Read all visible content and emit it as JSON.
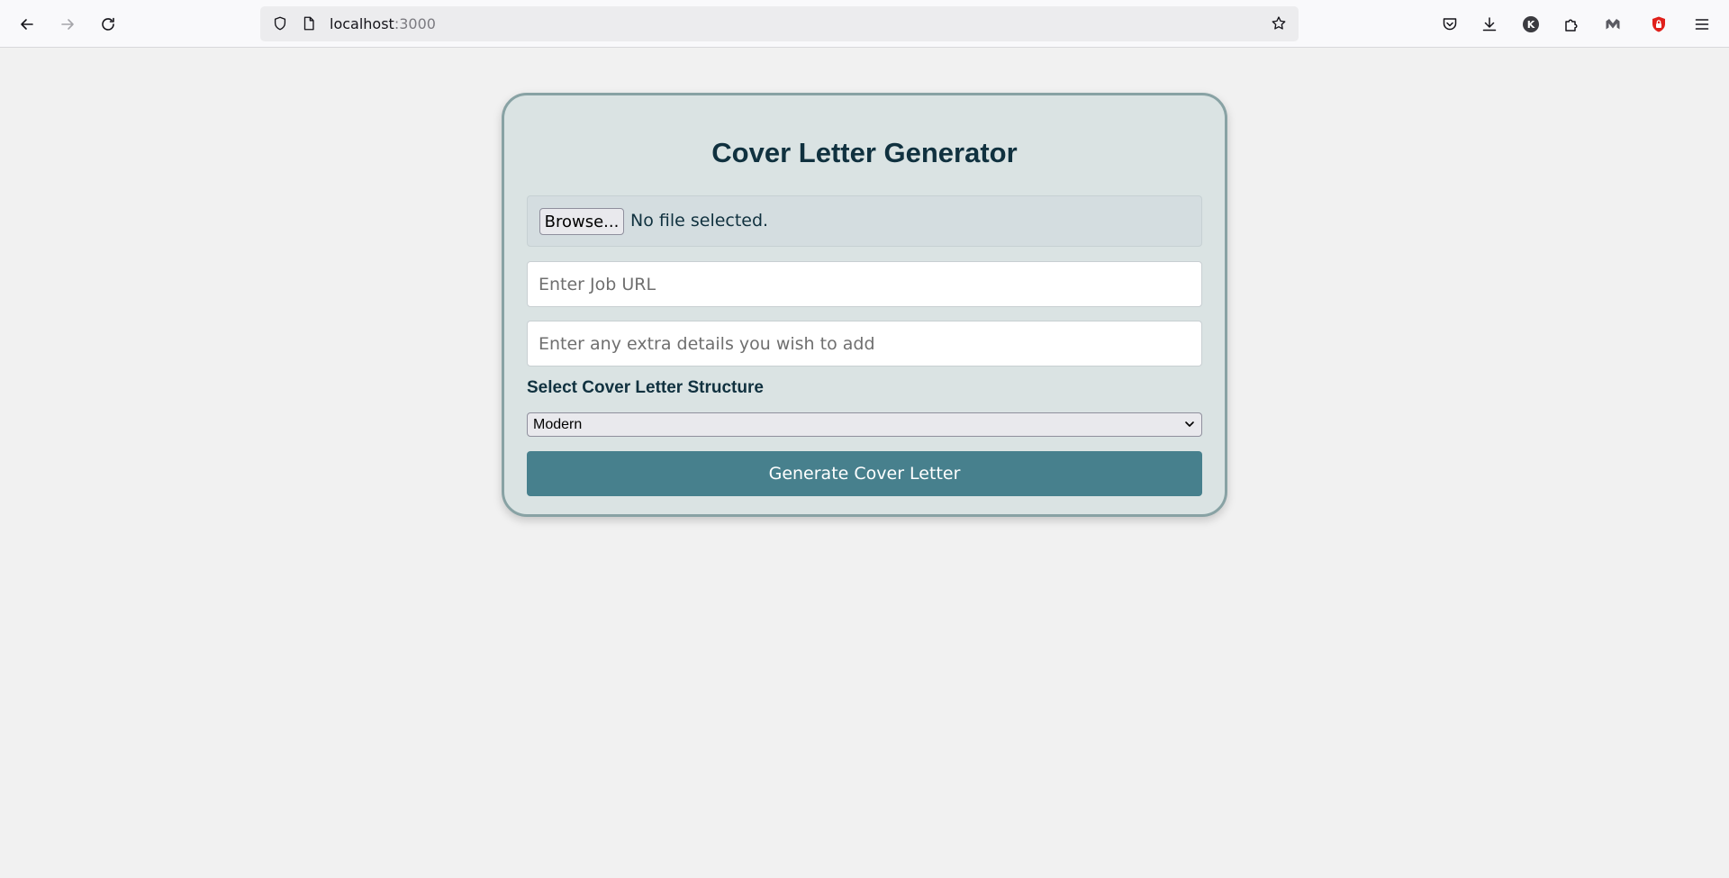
{
  "browser": {
    "url_host": "localhost",
    "url_port": ":3000",
    "icons": [
      "back-icon",
      "forward-icon",
      "reload-icon",
      "shield-icon",
      "page-icon",
      "bookmark-star-icon",
      "pocket-icon",
      "download-icon",
      "account-k-icon",
      "extensions-icon",
      "malwarebytes-icon",
      "adblock-shield-icon",
      "menu-icon"
    ],
    "account_initial": "K"
  },
  "form": {
    "title": "Cover Letter Generator",
    "browse_label": "Browse...",
    "file_status": "No file selected.",
    "job_url_placeholder": "Enter Job URL",
    "extra_details_placeholder": "Enter any extra details you wish to add",
    "structure_label": "Select Cover Letter Structure",
    "structure_selected": "Modern",
    "generate_label": "Generate Cover Letter"
  },
  "colors": {
    "page_background": "#f1f1f1",
    "card_background": "#dae3e3",
    "card_border": "#88a2a4",
    "title_text": "#10313f",
    "button_primary": "#47808d"
  }
}
